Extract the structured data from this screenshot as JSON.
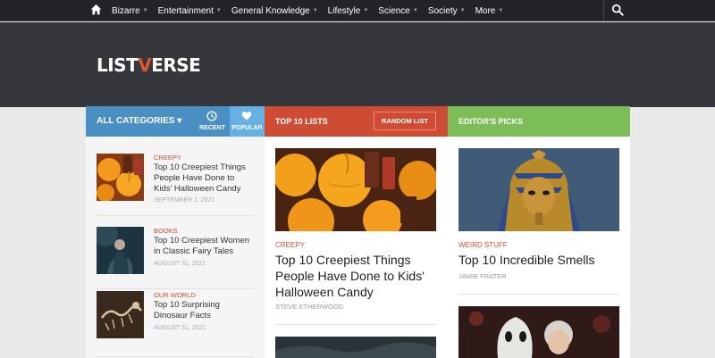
{
  "nav": {
    "items": [
      {
        "label": "Bizarre"
      },
      {
        "label": "Entertainment"
      },
      {
        "label": "General Knowledge"
      },
      {
        "label": "Lifestyle"
      },
      {
        "label": "Science"
      },
      {
        "label": "Society"
      },
      {
        "label": "More"
      }
    ],
    "icons": [
      "home-icon",
      "search-icon"
    ]
  },
  "header": {
    "logo_part1": "LIST",
    "logo_v": "V",
    "logo_part2": "ERSE",
    "logo_accent": "#e0542f"
  },
  "bar": {
    "all_categories": "ALL CATEGORIES",
    "recent": "RECENT",
    "popular": "POPULAR",
    "top10": "TOP 10 LISTS",
    "random": "RANDOM LIST",
    "editor": "EDITOR'S PICKS",
    "colors": {
      "blue": "#4a8fc3",
      "red": "#cf4c34",
      "green": "#7cbd58"
    }
  },
  "left_list": [
    {
      "category": "CREEPY",
      "title": "Top 10 Creepiest Things People Have Done to Kids' Halloween Candy",
      "date": "SEPTEMBER 1, 2021"
    },
    {
      "category": "BOOKS",
      "title": "Top 10 Creepiest Women in Classic Fairy Tales",
      "date": "AUGUST 31, 2021"
    },
    {
      "category": "OUR WORLD",
      "title": "Top 10 Surprising Dinosaur Facts",
      "date": "AUGUST 31, 2021"
    }
  ],
  "top10": {
    "category": "CREEPY",
    "title": "Top 10 Creepiest Things People Have Done to Kids' Halloween Candy",
    "author": "STEVE ETHERWOOD"
  },
  "editor": {
    "category": "WEIRD STUFF",
    "title": "Top 10 Incredible Smells",
    "author": "JAMIE FRATER"
  }
}
